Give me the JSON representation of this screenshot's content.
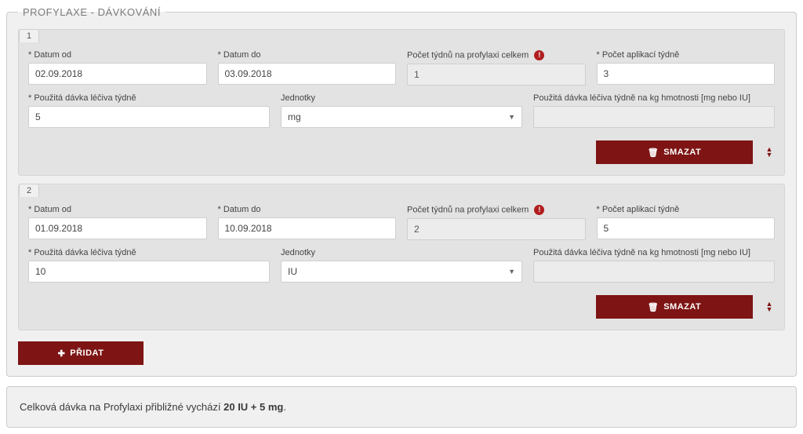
{
  "section": {
    "legend": "PROFYLAXE - DÁVKOVÁNÍ"
  },
  "labels": {
    "datum_od": "* Datum od",
    "datum_do": "* Datum do",
    "pocet_tydnu": "Počet týdnů na profylaxi celkem",
    "pocet_aplikaci": "* Počet aplikací týdně",
    "davka_tydne": "* Použitá dávka léčiva týdně",
    "jednotky": "Jednotky",
    "davka_kg": "Použitá dávka léčiva týdně na kg hmotnosti [mg nebo IU]"
  },
  "buttons": {
    "smazat": "SMAZAT",
    "pridat": "PŘIDAT"
  },
  "entries": [
    {
      "index": "1",
      "datum_od": "02.09.2018",
      "datum_do": "03.09.2018",
      "pocet_tydnu": "1",
      "pocet_aplikaci": "3",
      "davka_tydne": "5",
      "jednotky": "mg",
      "davka_kg": ""
    },
    {
      "index": "2",
      "datum_od": "01.09.2018",
      "datum_do": "10.09.2018",
      "pocet_tydnu": "2",
      "pocet_aplikaci": "5",
      "davka_tydne": "10",
      "jednotky": "IU",
      "davka_kg": ""
    }
  ],
  "summary": {
    "prefix": "Celková dávka na Profylaxi přibližné vychází ",
    "value": "20 IU + 5 mg",
    "suffix": "."
  }
}
